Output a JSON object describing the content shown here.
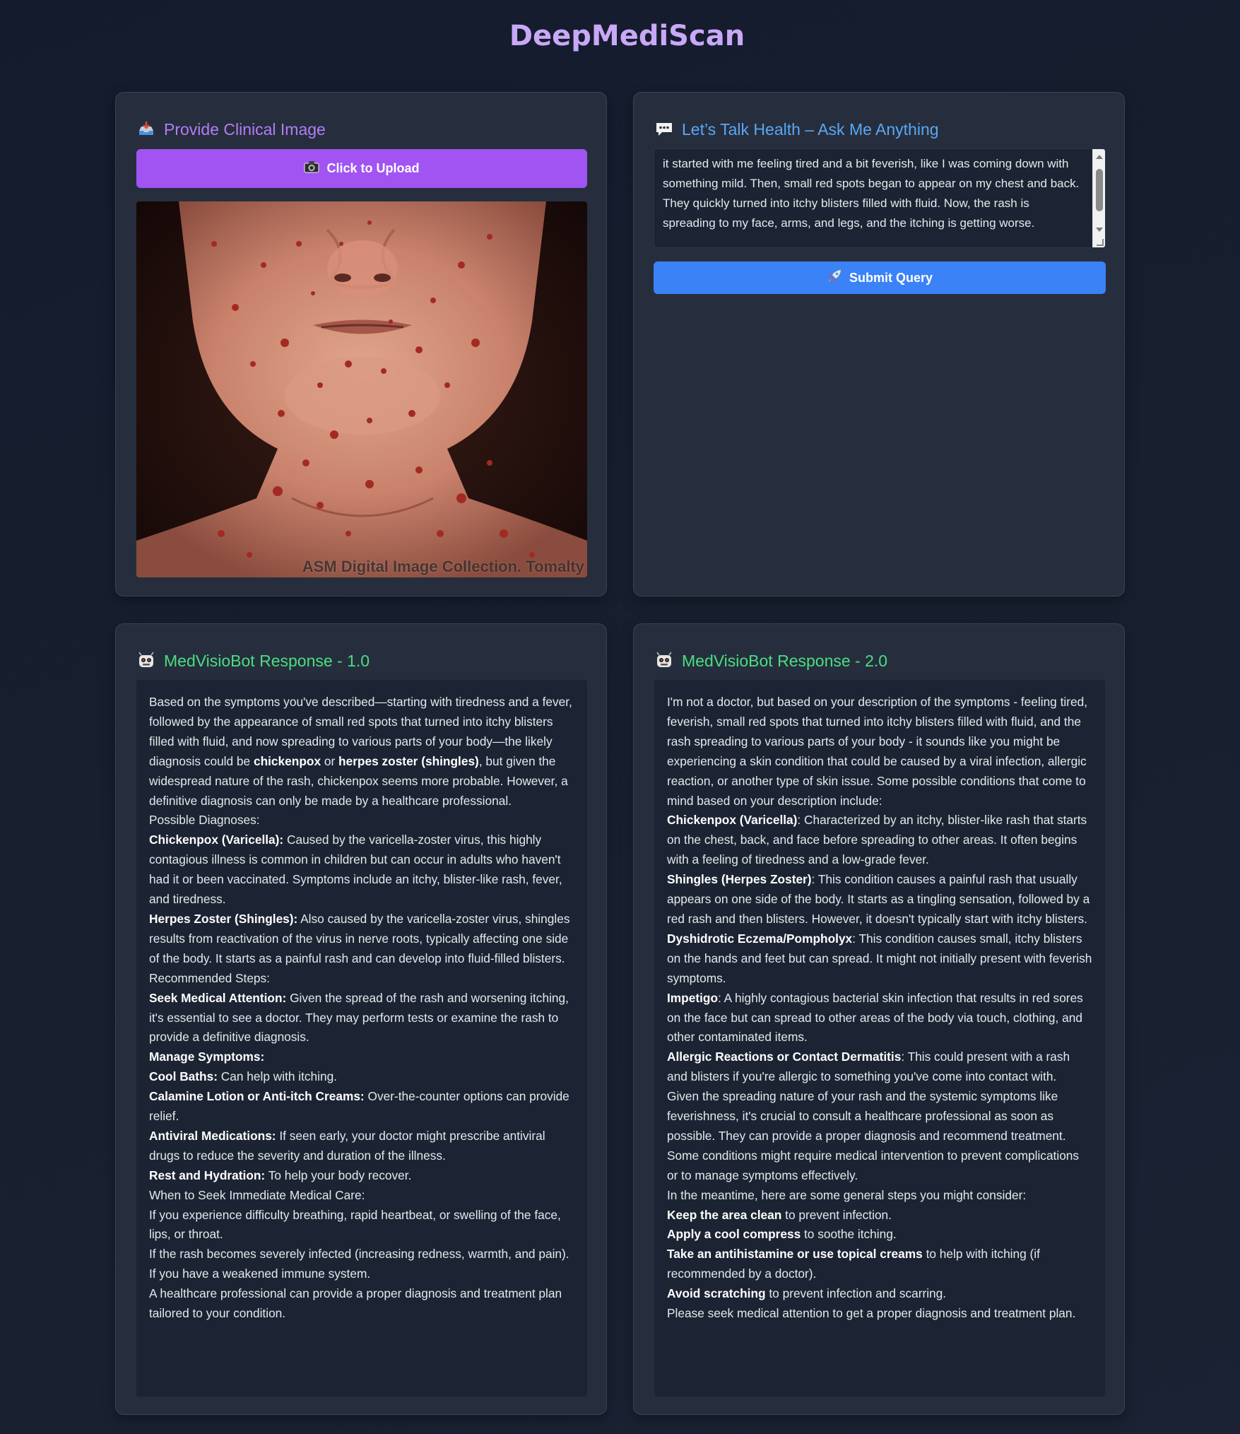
{
  "app": {
    "title": "DeepMediScan"
  },
  "image_panel": {
    "title": "Provide Clinical Image",
    "upload_label": "Click to Upload",
    "photo_caption": "ASM Digital Image Collection. Tomalty"
  },
  "chat_panel": {
    "title": "Let’s Talk Health – Ask Me Anything",
    "query_text": "it started with me feeling tired and a bit feverish, like I was coming down with something mild. Then, small red spots began to appear on my chest and back. They quickly turned into itchy blisters filled with fluid. Now, the rash is spreading to my face, arms, and legs, and the itching is getting worse.",
    "submit_label": "Submit Query"
  },
  "response1": {
    "title": "MedVisioBot Response - 1.0",
    "intro": {
      "a": "Based on the symptoms you've described—starting with tiredness and a fever, followed by the appearance of small red spots that turned into itchy blisters filled with fluid, and now spreading to various parts of your body—the likely diagnosis could be ",
      "b1": "chickenpox",
      "c": " or ",
      "b2": "herpes zoster (shingles)",
      "d": ", but given the widespread nature of the rash, chickenpox seems more probable. However, a definitive diagnosis can only be made by a healthcare professional."
    },
    "possible_heading": "Possible Diagnoses:",
    "chickenpox": {
      "label": "Chickenpox (Varicella):",
      "text": " Caused by the varicella-zoster virus, this highly contagious illness is common in children but can occur in adults who haven't had it or been vaccinated. Symptoms include an itchy, blister-like rash, fever, and tiredness."
    },
    "shingles": {
      "label": "Herpes Zoster (Shingles):",
      "text": " Also caused by the varicella-zoster virus, shingles results from reactivation of the virus in nerve roots, typically affecting one side of the body. It starts as a painful rash and can develop into fluid-filled blisters."
    },
    "steps_heading": "Recommended Steps:",
    "seek": {
      "label": "Seek Medical Attention:",
      "text": " Given the spread of the rash and worsening itching, it's essential to see a doctor. They may perform tests or examine the rash to provide a definitive diagnosis."
    },
    "manage": {
      "label": "Manage Symptoms:"
    },
    "baths": {
      "label": "Cool Baths:",
      "text": " Can help with itching."
    },
    "calamine": {
      "label": "Calamine Lotion or Anti-itch Creams:",
      "text": " Over-the-counter options can provide relief."
    },
    "antiviral": {
      "label": "Antiviral Medications:",
      "text": " If seen early, your doctor might prescribe antiviral drugs to reduce the severity and duration of the illness."
    },
    "rest": {
      "label": "Rest and Hydration:",
      "text": " To help your body recover."
    },
    "when_heading": "When to Seek Immediate Medical Care:",
    "when1": "If you experience difficulty breathing, rapid heartbeat, or swelling of the face, lips, or throat.",
    "when2": "If the rash becomes severely infected (increasing redness, warmth, and pain).",
    "when3": "If you have a weakened immune system.",
    "closing": "A healthcare professional can provide a proper diagnosis and treatment plan tailored to your condition."
  },
  "response2": {
    "title": "MedVisioBot Response - 2.0",
    "intro": "I'm not a doctor, but based on your description of the symptoms - feeling tired, feverish, small red spots that turned into itchy blisters filled with fluid, and the rash spreading to various parts of your body - it sounds like you might be experiencing a skin condition that could be caused by a viral infection, allergic reaction, or another type of skin issue. Some possible conditions that come to mind based on your description include:",
    "chickenpox": {
      "label": "Chickenpox (Varicella)",
      "text": ": Characterized by an itchy, blister-like rash that starts on the chest, back, and face before spreading to other areas. It often begins with a feeling of tiredness and a low-grade fever."
    },
    "shingles": {
      "label": "Shingles (Herpes Zoster)",
      "text": ": This condition causes a painful rash that usually appears on one side of the body. It starts as a tingling sensation, followed by a red rash and then blisters. However, it doesn't typically start with itchy blisters."
    },
    "eczema": {
      "label": "Dyshidrotic Eczema/Pompholyx",
      "text": ": This condition causes small, itchy blisters on the hands and feet but can spread. It might not initially present with feverish symptoms."
    },
    "impetigo": {
      "label": "Impetigo",
      "text": ": A highly contagious bacterial skin infection that results in red sores on the face but can spread to other areas of the body via touch, clothing, and other contaminated items."
    },
    "allergic": {
      "label": "Allergic Reactions or Contact Dermatitis",
      "text": ": This could present with a rash and blisters if you're allergic to something you've come into contact with."
    },
    "advice": "Given the spreading nature of your rash and the systemic symptoms like feverishness, it's crucial to consult a healthcare professional as soon as possible. They can provide a proper diagnosis and recommend treatment. Some conditions might require medical intervention to prevent complications or to manage symptoms effectively.",
    "meantime": "In the meantime, here are some general steps you might consider:",
    "clean": {
      "label": "Keep the area clean",
      "text": " to prevent infection."
    },
    "compress": {
      "label": "Apply a cool compress",
      "text": " to soothe itching."
    },
    "antihistamine": {
      "label": "Take an antihistamine or use topical creams",
      "text": " to help with itching (if recommended by a doctor)."
    },
    "scratching": {
      "label": "Avoid scratching",
      "text": " to prevent infection and scarring."
    },
    "closing": "Please seek medical attention to get a proper diagnosis and treatment plan."
  },
  "colors": {
    "upload_button": "#a154f2",
    "submit_button": "#3b82f6",
    "title_purple": "#b47cf5",
    "title_blue": "#5aa7f5",
    "title_green": "#4ade80"
  },
  "icons": {
    "image_panel": "inbox-tray-icon",
    "upload": "camera-icon",
    "chat_panel": "speech-bubble-icon",
    "submit": "rocket-icon",
    "response": "robot-icon"
  }
}
